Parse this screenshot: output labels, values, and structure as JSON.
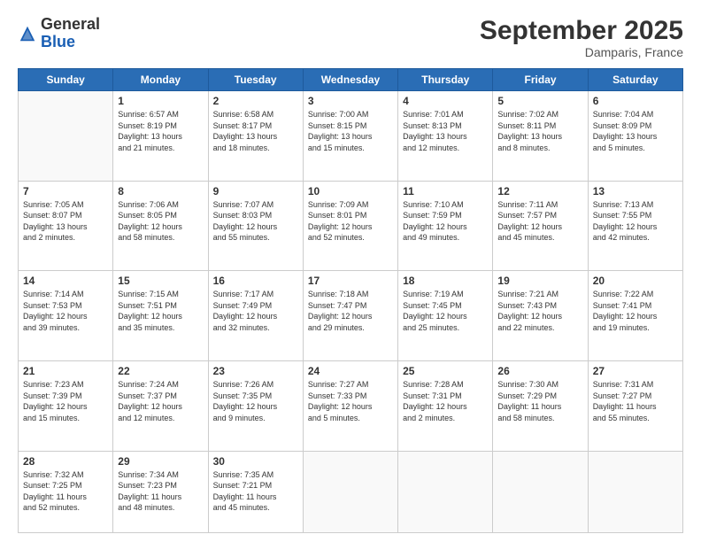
{
  "logo": {
    "general": "General",
    "blue": "Blue"
  },
  "header": {
    "month": "September 2025",
    "location": "Damparis, France"
  },
  "days_of_week": [
    "Sunday",
    "Monday",
    "Tuesday",
    "Wednesday",
    "Thursday",
    "Friday",
    "Saturday"
  ],
  "weeks": [
    [
      {
        "day": "",
        "info": ""
      },
      {
        "day": "1",
        "info": "Sunrise: 6:57 AM\nSunset: 8:19 PM\nDaylight: 13 hours\nand 21 minutes."
      },
      {
        "day": "2",
        "info": "Sunrise: 6:58 AM\nSunset: 8:17 PM\nDaylight: 13 hours\nand 18 minutes."
      },
      {
        "day": "3",
        "info": "Sunrise: 7:00 AM\nSunset: 8:15 PM\nDaylight: 13 hours\nand 15 minutes."
      },
      {
        "day": "4",
        "info": "Sunrise: 7:01 AM\nSunset: 8:13 PM\nDaylight: 13 hours\nand 12 minutes."
      },
      {
        "day": "5",
        "info": "Sunrise: 7:02 AM\nSunset: 8:11 PM\nDaylight: 13 hours\nand 8 minutes."
      },
      {
        "day": "6",
        "info": "Sunrise: 7:04 AM\nSunset: 8:09 PM\nDaylight: 13 hours\nand 5 minutes."
      }
    ],
    [
      {
        "day": "7",
        "info": "Sunrise: 7:05 AM\nSunset: 8:07 PM\nDaylight: 13 hours\nand 2 minutes."
      },
      {
        "day": "8",
        "info": "Sunrise: 7:06 AM\nSunset: 8:05 PM\nDaylight: 12 hours\nand 58 minutes."
      },
      {
        "day": "9",
        "info": "Sunrise: 7:07 AM\nSunset: 8:03 PM\nDaylight: 12 hours\nand 55 minutes."
      },
      {
        "day": "10",
        "info": "Sunrise: 7:09 AM\nSunset: 8:01 PM\nDaylight: 12 hours\nand 52 minutes."
      },
      {
        "day": "11",
        "info": "Sunrise: 7:10 AM\nSunset: 7:59 PM\nDaylight: 12 hours\nand 49 minutes."
      },
      {
        "day": "12",
        "info": "Sunrise: 7:11 AM\nSunset: 7:57 PM\nDaylight: 12 hours\nand 45 minutes."
      },
      {
        "day": "13",
        "info": "Sunrise: 7:13 AM\nSunset: 7:55 PM\nDaylight: 12 hours\nand 42 minutes."
      }
    ],
    [
      {
        "day": "14",
        "info": "Sunrise: 7:14 AM\nSunset: 7:53 PM\nDaylight: 12 hours\nand 39 minutes."
      },
      {
        "day": "15",
        "info": "Sunrise: 7:15 AM\nSunset: 7:51 PM\nDaylight: 12 hours\nand 35 minutes."
      },
      {
        "day": "16",
        "info": "Sunrise: 7:17 AM\nSunset: 7:49 PM\nDaylight: 12 hours\nand 32 minutes."
      },
      {
        "day": "17",
        "info": "Sunrise: 7:18 AM\nSunset: 7:47 PM\nDaylight: 12 hours\nand 29 minutes."
      },
      {
        "day": "18",
        "info": "Sunrise: 7:19 AM\nSunset: 7:45 PM\nDaylight: 12 hours\nand 25 minutes."
      },
      {
        "day": "19",
        "info": "Sunrise: 7:21 AM\nSunset: 7:43 PM\nDaylight: 12 hours\nand 22 minutes."
      },
      {
        "day": "20",
        "info": "Sunrise: 7:22 AM\nSunset: 7:41 PM\nDaylight: 12 hours\nand 19 minutes."
      }
    ],
    [
      {
        "day": "21",
        "info": "Sunrise: 7:23 AM\nSunset: 7:39 PM\nDaylight: 12 hours\nand 15 minutes."
      },
      {
        "day": "22",
        "info": "Sunrise: 7:24 AM\nSunset: 7:37 PM\nDaylight: 12 hours\nand 12 minutes."
      },
      {
        "day": "23",
        "info": "Sunrise: 7:26 AM\nSunset: 7:35 PM\nDaylight: 12 hours\nand 9 minutes."
      },
      {
        "day": "24",
        "info": "Sunrise: 7:27 AM\nSunset: 7:33 PM\nDaylight: 12 hours\nand 5 minutes."
      },
      {
        "day": "25",
        "info": "Sunrise: 7:28 AM\nSunset: 7:31 PM\nDaylight: 12 hours\nand 2 minutes."
      },
      {
        "day": "26",
        "info": "Sunrise: 7:30 AM\nSunset: 7:29 PM\nDaylight: 11 hours\nand 58 minutes."
      },
      {
        "day": "27",
        "info": "Sunrise: 7:31 AM\nSunset: 7:27 PM\nDaylight: 11 hours\nand 55 minutes."
      }
    ],
    [
      {
        "day": "28",
        "info": "Sunrise: 7:32 AM\nSunset: 7:25 PM\nDaylight: 11 hours\nand 52 minutes."
      },
      {
        "day": "29",
        "info": "Sunrise: 7:34 AM\nSunset: 7:23 PM\nDaylight: 11 hours\nand 48 minutes."
      },
      {
        "day": "30",
        "info": "Sunrise: 7:35 AM\nSunset: 7:21 PM\nDaylight: 11 hours\nand 45 minutes."
      },
      {
        "day": "",
        "info": ""
      },
      {
        "day": "",
        "info": ""
      },
      {
        "day": "",
        "info": ""
      },
      {
        "day": "",
        "info": ""
      }
    ]
  ]
}
